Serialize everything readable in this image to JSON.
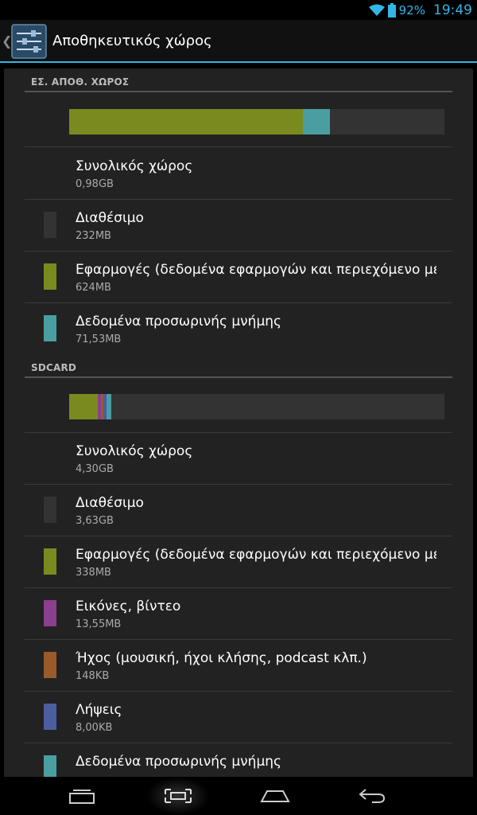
{
  "status_bar": {
    "battery": "92%",
    "time": "19:49",
    "icons": [
      "wifi-icon",
      "battery-icon"
    ]
  },
  "action_bar": {
    "title": "Αποθηκευτικός χώρος",
    "icon": "settings-sliders-icon"
  },
  "internal": {
    "header": "ΕΣ. ΑΠΟΘ. ΧΩΡΟΣ",
    "usage_segments": [
      {
        "label": "Εφαρμογές",
        "fraction": 0.622,
        "color": "#7b8a1e"
      },
      {
        "label": "Δεδομένα προσωρινής μνήμης",
        "fraction": 0.072,
        "color": "#4a9ea1"
      }
    ],
    "rows": [
      {
        "title": "Συνολικός χώρος",
        "value": "0,98GB",
        "color": ""
      },
      {
        "title": "Διαθέσιμο",
        "value": "232MB",
        "color": "#333333"
      },
      {
        "title": "Εφαρμογές (δεδομένα εφαρμογών και περιεχόμενο μέσ",
        "value": "624MB",
        "color": "#7b8a1e"
      },
      {
        "title": "Δεδομένα προσωρινής μνήμης",
        "value": "71,53MB",
        "color": "#4a9ea1"
      }
    ]
  },
  "sdcard": {
    "header": "SDCARD",
    "usage_segments": [
      {
        "label": "Εφαρμογές",
        "fraction": 0.076,
        "color": "#7b8a1e"
      },
      {
        "label": "Εικόνες, βίντεο",
        "fraction": 0.008,
        "color": "#8a3f8f"
      },
      {
        "label": "Ήχος",
        "fraction": 0.008,
        "color": "#9a5a2a"
      },
      {
        "label": "Λήψεις",
        "fraction": 0.008,
        "color": "#4a5ea0"
      },
      {
        "label": "Δεδομένα προσωρινής μνήμης",
        "fraction": 0.013,
        "color": "#4a9ea1"
      }
    ],
    "rows": [
      {
        "title": "Συνολικός χώρος",
        "value": "4,30GB",
        "color": ""
      },
      {
        "title": "Διαθέσιμο",
        "value": "3,63GB",
        "color": "#333333"
      },
      {
        "title": "Εφαρμογές (δεδομένα εφαρμογών και περιεχόμενο μέσ",
        "value": "338MB",
        "color": "#7b8a1e"
      },
      {
        "title": "Εικόνες, βίντεο",
        "value": "13,55MB",
        "color": "#8a3f8f"
      },
      {
        "title": "Ήχος (μουσική, ήχοι κλήσης, podcast κλπ.)",
        "value": "148KB",
        "color": "#9a5a2a"
      },
      {
        "title": "Λήψεις",
        "value": "8,00KB",
        "color": "#4a5ea0"
      },
      {
        "title": "Δεδομένα προσωρινής μνήμης",
        "value": "",
        "color": "#4a9ea1"
      }
    ]
  },
  "nav_bar": {
    "buttons": [
      "recent-apps-icon",
      "screenshot-icon",
      "home-icon",
      "back-icon"
    ]
  },
  "colors": {
    "accent": "#33b5e5",
    "panel_bg": "#222222"
  }
}
